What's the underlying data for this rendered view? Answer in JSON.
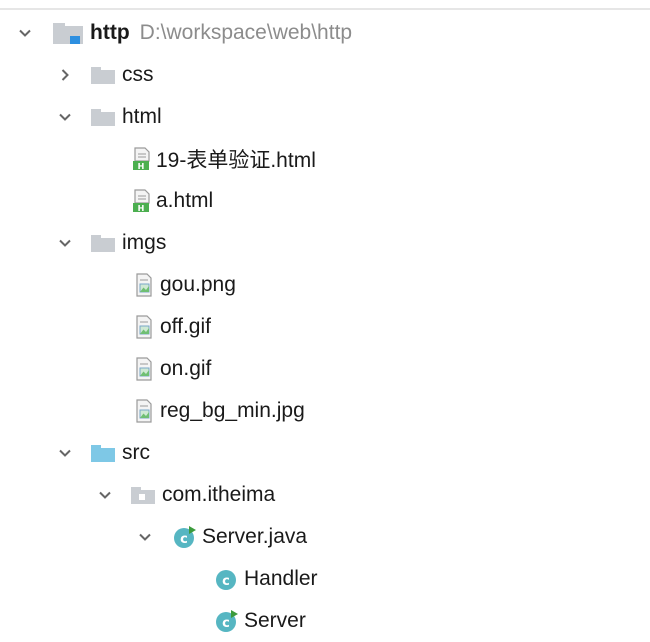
{
  "tree": {
    "root": {
      "name": "http",
      "path": "D:\\workspace\\web\\http",
      "icon": "project-folder-icon"
    },
    "items": [
      {
        "label": "css",
        "icon": "folder-icon",
        "state": "collapsed"
      },
      {
        "label": "html",
        "icon": "folder-icon",
        "state": "expanded"
      },
      {
        "label": "19-表单验证.html",
        "icon": "html-file-icon"
      },
      {
        "label": "a.html",
        "icon": "html-file-icon"
      },
      {
        "label": "imgs",
        "icon": "folder-icon",
        "state": "expanded"
      },
      {
        "label": "gou.png",
        "icon": "image-file-icon"
      },
      {
        "label": "off.gif",
        "icon": "image-file-icon"
      },
      {
        "label": "on.gif",
        "icon": "image-file-icon"
      },
      {
        "label": "reg_bg_min.jpg",
        "icon": "image-file-icon"
      },
      {
        "label": "src",
        "icon": "source-folder-icon",
        "state": "expanded"
      },
      {
        "label": "com.itheima",
        "icon": "package-icon",
        "state": "expanded"
      },
      {
        "label": "Server.java",
        "icon": "java-class-runnable-icon",
        "state": "expanded"
      },
      {
        "label": "Handler",
        "icon": "java-class-icon"
      },
      {
        "label": "Server",
        "icon": "java-class-runnable-icon"
      }
    ]
  },
  "colors": {
    "folder": "#c9cdd2",
    "source_folder": "#7ec8e6",
    "html_badge": "#4caf50",
    "class_icon": "#56b6c2",
    "path_text": "#8c8c8c"
  }
}
